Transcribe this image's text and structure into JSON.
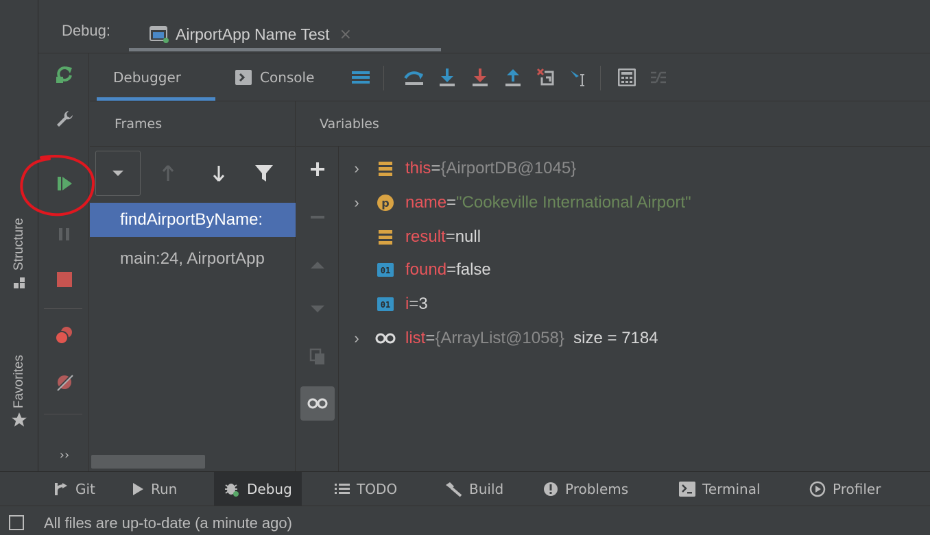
{
  "header": {
    "debug_label": "Debug:",
    "run_config_tab": "AirportApp Name Test",
    "close_glyph": "×"
  },
  "left_stripe": {
    "structure_label": "Structure",
    "favorites_label": "Favorites"
  },
  "toolbar": {
    "debugger_tab": "Debugger",
    "console_tab": "Console"
  },
  "frames": {
    "title": "Frames",
    "items": [
      {
        "label": "findAirportByName:",
        "selected": true
      },
      {
        "label": "main:24, AirportApp",
        "selected": false
      }
    ]
  },
  "variables": {
    "title": "Variables",
    "items": [
      {
        "expandable": true,
        "icon": "field-icon",
        "name": "this",
        "eq": " = ",
        "value": "{AirportDB@1045}",
        "kind": "ref",
        "extra": ""
      },
      {
        "expandable": true,
        "icon": "parameter-icon",
        "name": "name",
        "eq": " = ",
        "value": "\"Cookeville International Airport\"",
        "kind": "string",
        "extra": ""
      },
      {
        "expandable": false,
        "icon": "field-icon",
        "name": "result",
        "eq": " = ",
        "value": "null",
        "kind": "plain",
        "extra": ""
      },
      {
        "expandable": false,
        "icon": "primitive-icon",
        "name": "found",
        "eq": " = ",
        "value": "false",
        "kind": "plain",
        "extra": ""
      },
      {
        "expandable": false,
        "icon": "primitive-icon",
        "name": "i",
        "eq": " = ",
        "value": "3",
        "kind": "plain",
        "extra": ""
      },
      {
        "expandable": true,
        "icon": "watch-icon",
        "name": "list",
        "eq": " = ",
        "value": "{ArrayList@1058}",
        "kind": "ref",
        "extra": "  size = 7184"
      }
    ]
  },
  "bottom_bar": {
    "git": "Git",
    "run": "Run",
    "debug": "Debug",
    "todo": "TODO",
    "build": "Build",
    "problems": "Problems",
    "terminal": "Terminal",
    "profiler": "Profiler"
  },
  "status": {
    "text": "All files are up-to-date (a minute ago)"
  },
  "colors": {
    "background": "#3c3f41",
    "selection": "#4b6eaf",
    "variable_name": "#e8555b",
    "string_value": "#6a8759",
    "resume_green": "#59a869",
    "stop_red": "#c75450",
    "annotation_red": "#e0171f",
    "step_blue": "#3592c4"
  },
  "marker_glyph": "›"
}
